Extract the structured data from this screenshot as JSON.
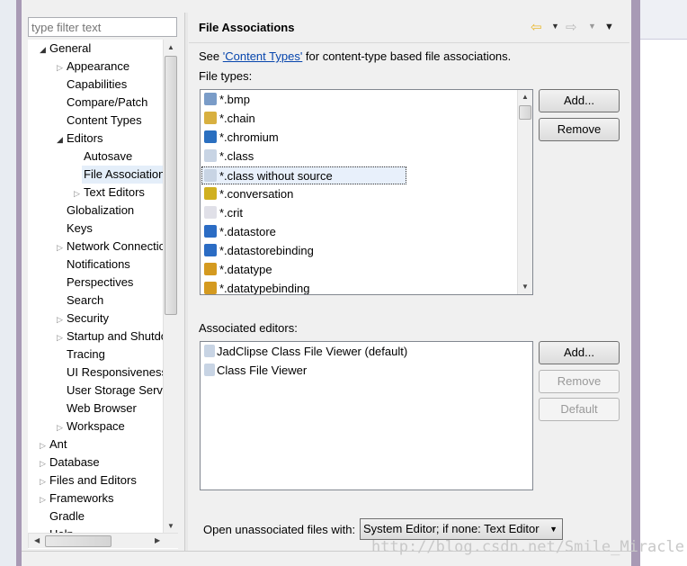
{
  "filter": {
    "placeholder": "type filter text"
  },
  "tree": [
    {
      "label": "General",
      "level": 0,
      "expander": "expanded"
    },
    {
      "label": "Appearance",
      "level": 1,
      "expander": "collapsed"
    },
    {
      "label": "Capabilities",
      "level": 1,
      "expander": "none"
    },
    {
      "label": "Compare/Patch",
      "level": 1,
      "expander": "none"
    },
    {
      "label": "Content Types",
      "level": 1,
      "expander": "none"
    },
    {
      "label": "Editors",
      "level": 1,
      "expander": "expanded"
    },
    {
      "label": "Autosave",
      "level": 2,
      "expander": "none"
    },
    {
      "label": "File Associations",
      "level": 2,
      "expander": "none",
      "selected": true
    },
    {
      "label": "Text Editors",
      "level": 2,
      "expander": "collapsed"
    },
    {
      "label": "Globalization",
      "level": 1,
      "expander": "none"
    },
    {
      "label": "Keys",
      "level": 1,
      "expander": "none"
    },
    {
      "label": "Network Connections",
      "level": 1,
      "expander": "collapsed"
    },
    {
      "label": "Notifications",
      "level": 1,
      "expander": "none"
    },
    {
      "label": "Perspectives",
      "level": 1,
      "expander": "none"
    },
    {
      "label": "Search",
      "level": 1,
      "expander": "none"
    },
    {
      "label": "Security",
      "level": 1,
      "expander": "collapsed"
    },
    {
      "label": "Startup and Shutdown",
      "level": 1,
      "expander": "collapsed"
    },
    {
      "label": "Tracing",
      "level": 1,
      "expander": "none"
    },
    {
      "label": "UI Responsiveness",
      "level": 1,
      "expander": "none"
    },
    {
      "label": "User Storage Service",
      "level": 1,
      "expander": "none"
    },
    {
      "label": "Web Browser",
      "level": 1,
      "expander": "none"
    },
    {
      "label": "Workspace",
      "level": 1,
      "expander": "collapsed"
    },
    {
      "label": "Ant",
      "level": 0,
      "expander": "collapsed"
    },
    {
      "label": "Database",
      "level": 0,
      "expander": "collapsed"
    },
    {
      "label": "Files and Editors",
      "level": 0,
      "expander": "collapsed"
    },
    {
      "label": "Frameworks",
      "level": 0,
      "expander": "collapsed"
    },
    {
      "label": "Gradle",
      "level": 0,
      "expander": "none"
    },
    {
      "label": "Help",
      "level": 0,
      "expander": "collapsed"
    }
  ],
  "page": {
    "title": "File Associations",
    "see_prefix": "See ",
    "see_link": "'Content Types'",
    "see_suffix": " for content-type based file associations.",
    "file_types_label": "File types:",
    "file_types": [
      {
        "label": "*.bmp",
        "icon": "image-icon",
        "color": "#7a9cc8"
      },
      {
        "label": "*.chain",
        "icon": "chain-icon",
        "color": "#d8b040"
      },
      {
        "label": "*.chromium",
        "icon": "chromium-icon",
        "color": "#2a6fc0"
      },
      {
        "label": "*.class",
        "icon": "class-file-icon",
        "color": "#c8d4e4"
      },
      {
        "label": "*.class without source",
        "icon": "class-file-icon",
        "color": "#c8d4e4",
        "selected": true
      },
      {
        "label": "*.conversation",
        "icon": "conversation-icon",
        "color": "#d0b020"
      },
      {
        "label": "*.crit",
        "icon": "crit-icon",
        "color": "#e0e0e8"
      },
      {
        "label": "*.datastore",
        "icon": "datastore-icon",
        "color": "#2b6cc4"
      },
      {
        "label": "*.datastorebinding",
        "icon": "datastore-icon",
        "color": "#2b6cc4"
      },
      {
        "label": "*.datatype",
        "icon": "datatype-icon",
        "color": "#d49a20"
      },
      {
        "label": "*.datatypebinding",
        "icon": "datatype-icon",
        "color": "#d49a20"
      }
    ],
    "add_label": "Add...",
    "remove_label": "Remove",
    "editors_label": "Associated editors:",
    "editors": [
      {
        "label": "JadClipse Class File Viewer (default)",
        "icon": "class-file-icon"
      },
      {
        "label": "Class File Viewer",
        "icon": "class-file-icon"
      }
    ],
    "editor_add_label": "Add...",
    "editor_remove_label": "Remove",
    "editor_default_label": "Default",
    "open_unassoc_label": "Open unassociated files with:",
    "open_unassoc_value": "System Editor; if none: Text Editor"
  },
  "watermark": "http://blog.csdn.net/Smile_Miracle"
}
